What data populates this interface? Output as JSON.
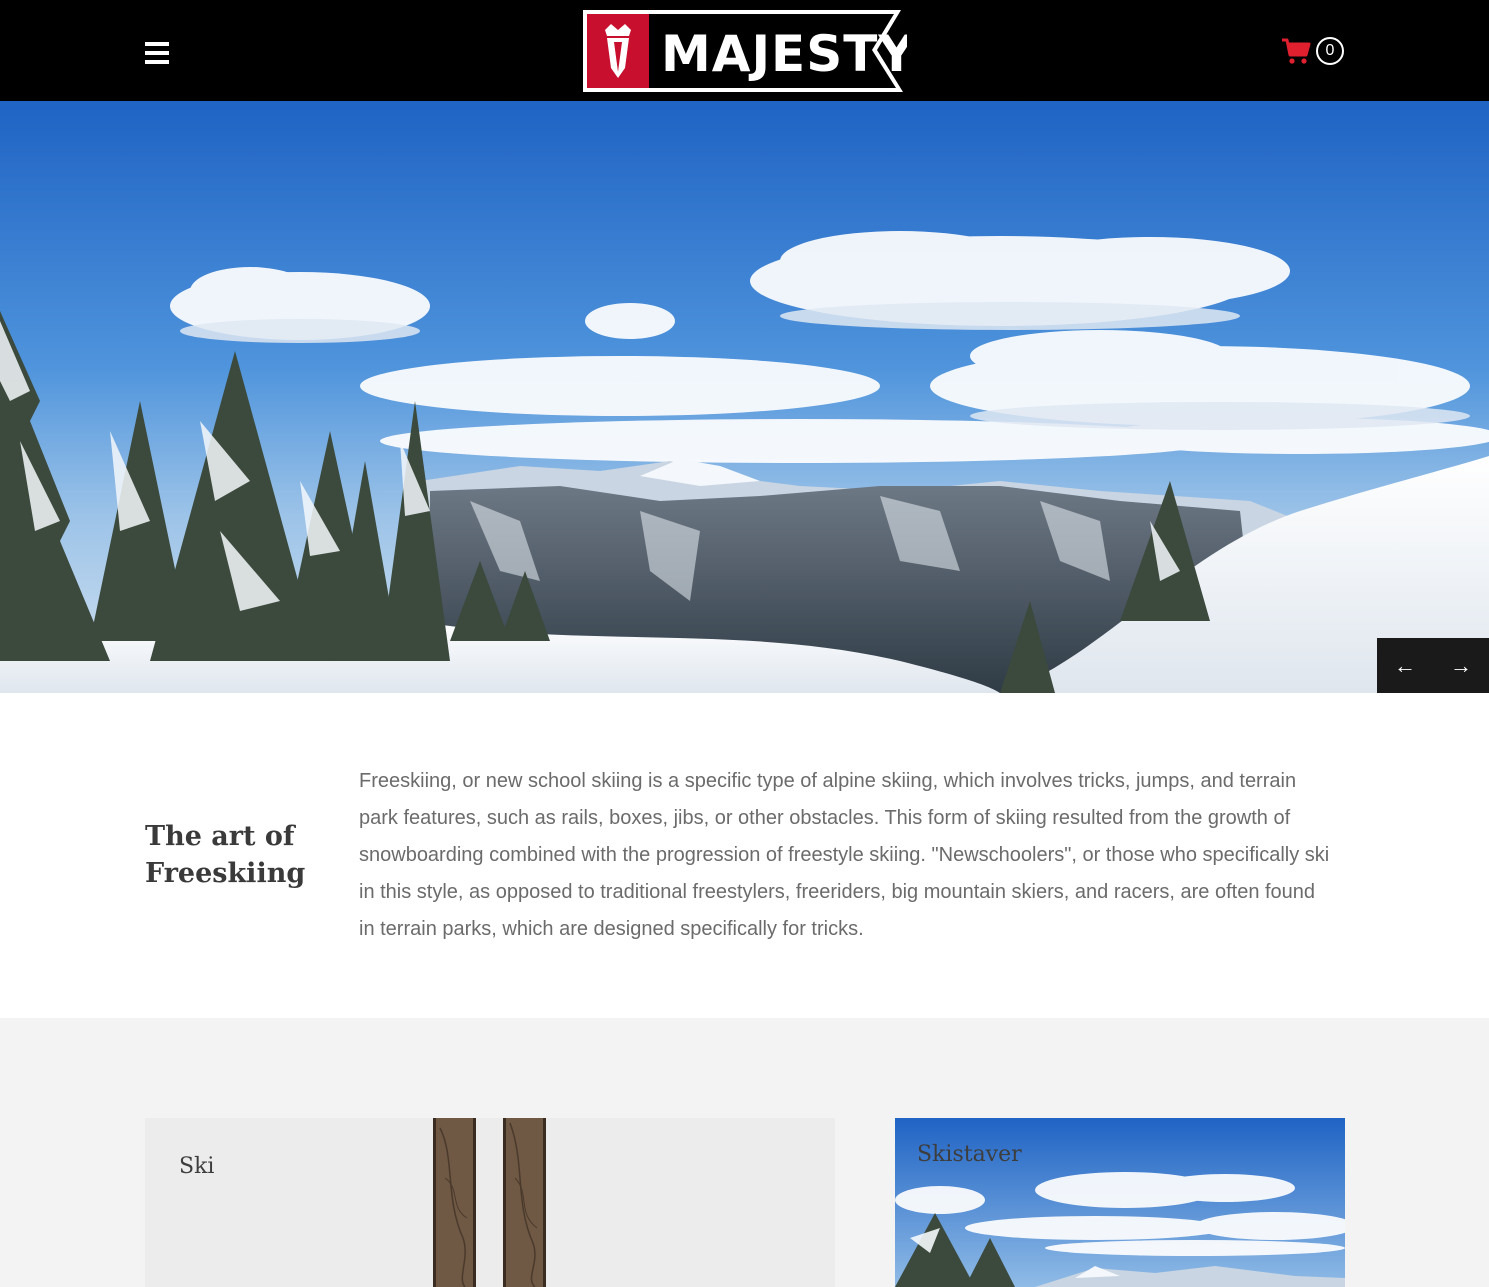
{
  "header": {
    "menu_icon": "hamburger-icon",
    "logo_text": "MAJESTY",
    "cart_icon": "cart-icon",
    "cart_count": "0",
    "colors": {
      "background": "#000000",
      "brand_red": "#c8102e",
      "cart_red": "#e0202f"
    }
  },
  "hero": {
    "prev_icon": "arrow-left-icon",
    "next_icon": "arrow-right-icon",
    "prev_label": "←",
    "next_label": "→"
  },
  "intro": {
    "title": "The art of Freeskiing",
    "body": "Freeskiing, or new school skiing is a specific type of alpine skiing, which involves tricks, jumps, and terrain park features, such as rails, boxes, jibs, or other obstacles. This form of skiing resulted from the growth of snowboarding combined with the progression of freestyle skiing. \"Newschoolers\", or those who specifically ski in this style, as opposed to traditional freestylers, freeriders, big mountain skiers, and racers, are often found in terrain parks, which are designed specifically for tricks."
  },
  "products": {
    "cards": [
      {
        "label": "Ski"
      },
      {
        "label": "Skistaver"
      }
    ]
  }
}
